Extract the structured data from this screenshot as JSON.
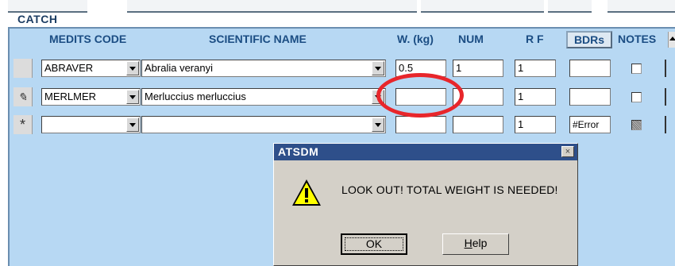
{
  "section_title": "CATCH",
  "columns": {
    "medits_code": "MEDITS CODE",
    "scientific_name": "SCIENTIFIC NAME",
    "weight": "W. (kg)",
    "num": "NUM",
    "rf": "R F",
    "bdrs": "BDRs",
    "notes": "NOTES"
  },
  "rows": [
    {
      "selector": "",
      "code": "ABRAVER",
      "name": "Abralia veranyi",
      "weight": "0.5",
      "num": "1",
      "rf": "1",
      "bdrs": "",
      "notes_checked": false,
      "notes_state": "unchecked"
    },
    {
      "selector": "✎",
      "code": "MERLMER",
      "name": "Merluccius merluccius",
      "weight": "",
      "num": "",
      "rf": "1",
      "bdrs": "",
      "notes_checked": false,
      "notes_state": "unchecked"
    },
    {
      "selector": "*",
      "code": "",
      "name": "",
      "weight": "",
      "num": "",
      "rf": "1",
      "bdrs": "#Error",
      "notes_checked": false,
      "notes_state": "indeterminate"
    }
  ],
  "dialog": {
    "title": "ATSDM",
    "close_symbol": "×",
    "message": "LOOK OUT! TOTAL WEIGHT IS NEEDED!",
    "ok_label": "OK",
    "help_prefix": "",
    "help_underlined": "H",
    "help_rest": "elp",
    "icon": "warning-icon"
  },
  "colors": {
    "panel": "#b7d8f3",
    "header_text": "#1b4d83",
    "dialog_title_bar": "#2e4f8a",
    "highlight_ellipse": "#e8262b"
  }
}
